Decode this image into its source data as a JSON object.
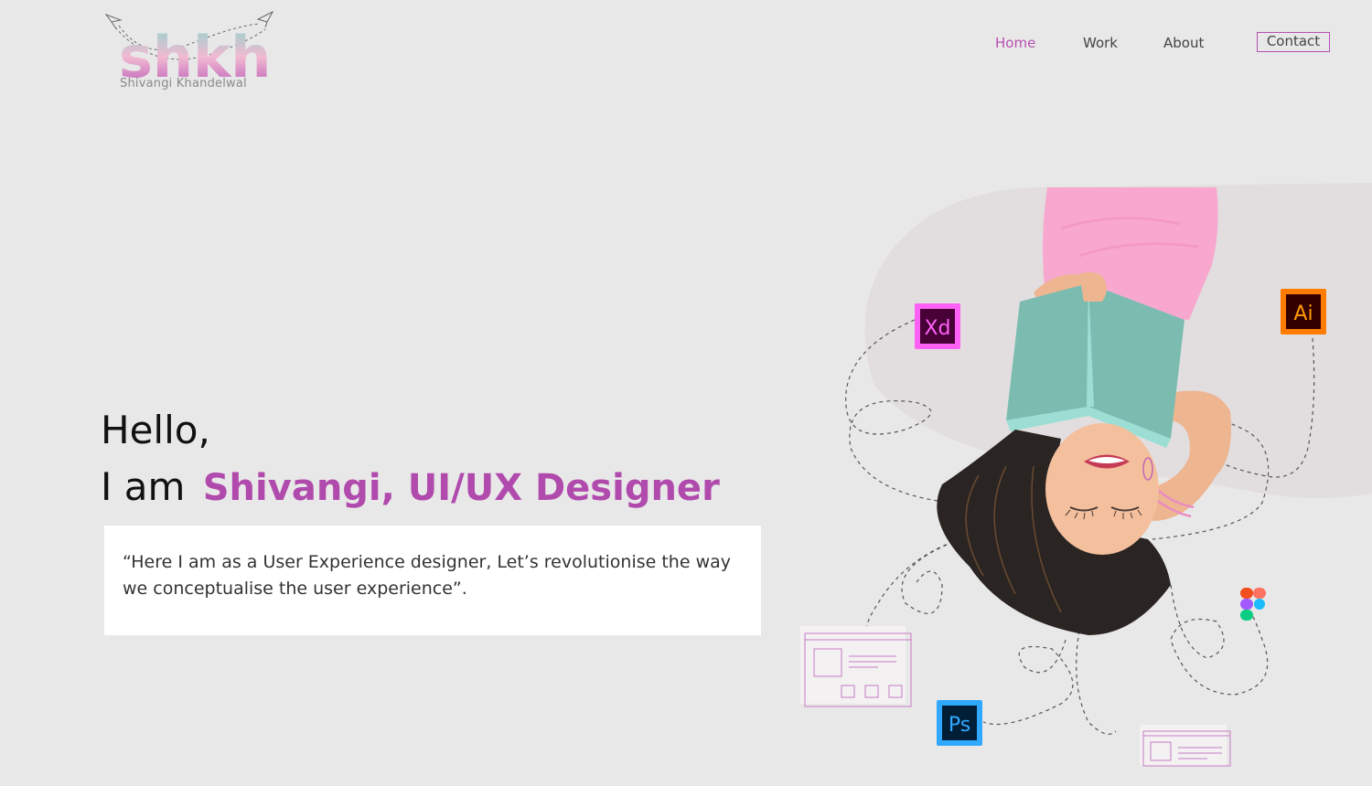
{
  "brand": {
    "logo_text": "shkh",
    "name": "Shivangi Khandelwal"
  },
  "nav": {
    "items": [
      "Home",
      "Work",
      "About"
    ],
    "active": "Home",
    "contact_label": "Contact"
  },
  "hero": {
    "greeting": "Hello,",
    "intro": "I am",
    "highlight": "Shivangi, UI/UX Designer",
    "quote": "“Here I am as a User Experience designer, Let’s revolutionise the way we conceptualise the user experience”."
  },
  "tools": {
    "xd": "Xd",
    "ai": "Ai",
    "ps": "Ps",
    "figma_icon": "figma-icon"
  },
  "colors": {
    "background": "#e9e8e8",
    "accent": "#b04aad",
    "xd": "#ff61f6",
    "ai": "#ff7c00",
    "ps": "#31a8ff"
  }
}
